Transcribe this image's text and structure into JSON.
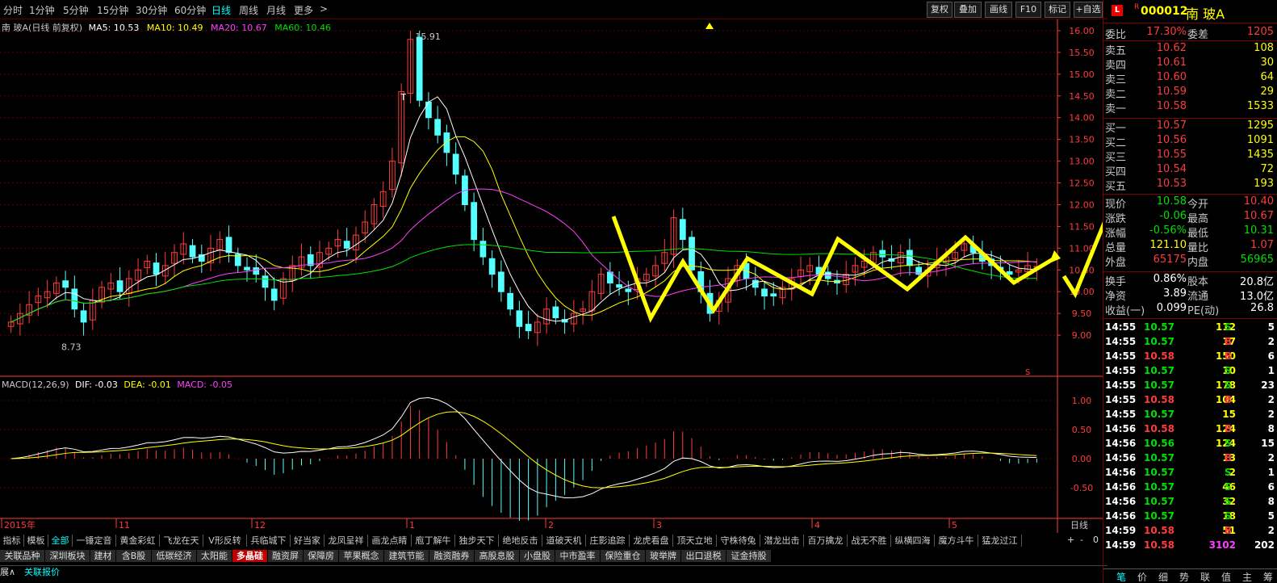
{
  "topbar": {
    "periods": [
      "分时",
      "1分钟",
      "5分钟",
      "15分钟",
      "30分钟",
      "60分钟",
      "日线",
      "周线",
      "月线",
      "更多"
    ],
    "more_arrow": ">",
    "active": "日线",
    "buttons": [
      "复权",
      "叠加",
      "画线",
      "F10",
      "标记",
      "+自选"
    ]
  },
  "legend": {
    "name": "南 玻A(日线 前复权)",
    "ma5": "MA5: 10.53",
    "ma10": "MA10: 10.49",
    "ma20": "MA20: 10.67",
    "ma60": "MA60: 10.46"
  },
  "colors": {
    "up": "#ff3c3c",
    "down": "#54ffff",
    "ma5": "#ffffff",
    "ma10": "#ffff00",
    "ma20": "#ff40ff",
    "ma60": "#00e000",
    "grid": "#7a0000",
    "axis": "#ff3c3c",
    "arrow": "#ffff00",
    "macd_pos": "#ff3c3c",
    "macd_neg": "#54ffff"
  },
  "price_axis": [
    "16.00",
    "15.50",
    "15.00",
    "14.50",
    "14.00",
    "13.50",
    "13.00",
    "12.50",
    "12.00",
    "11.50",
    "11.00",
    "10.50",
    "10.00",
    "9.50",
    "9.00"
  ],
  "annotations": {
    "high": "15.91",
    "low": "8.73",
    "t_mark": "T",
    "s_mark": "S"
  },
  "macd_legend": {
    "name": "MACD(12,26,9)",
    "dif": "DIF: -0.03",
    "dea": "DEA: -0.01",
    "macd": "MACD: -0.05"
  },
  "macd_axis": [
    "1.00",
    "0.50",
    "0.00",
    "-0.50"
  ],
  "date_axis": [
    "2015年",
    "11",
    "12",
    "1",
    "2",
    "3",
    "4",
    "5"
  ],
  "period_label": "日线",
  "indicator_tabs": [
    "指标",
    "模板",
    "全部",
    "一锤定音",
    "黄金彩虹",
    "飞龙在天",
    "V形反转",
    "兵临城下",
    "好当家",
    "龙凤呈祥",
    "画龙点睛",
    "庖丁解牛",
    "独步天下",
    "绝地反击",
    "道破天机",
    "庄影追踪",
    "龙虎看盘",
    "顶天立地",
    "守株待兔",
    "潜龙出击",
    "百万擒龙",
    "战无不胜",
    "纵横四海",
    "魔方斗牛",
    "猛龙过江"
  ],
  "indicator_active": "全部",
  "nav_controls": [
    "+",
    "-",
    "0"
  ],
  "sector_tabs": [
    "关联品种",
    "深圳板块",
    "建材",
    "含B股",
    "低碳经济",
    "太阳能",
    "多晶硅",
    "融资屏",
    "保障房",
    "苹果概念",
    "建筑节能",
    "融资融券",
    "高股息股",
    "小盘股",
    "中市盈率",
    "保险重仓",
    "玻举牌",
    "出口退税",
    "证金持股"
  ],
  "sector_active": "多晶硅",
  "status": {
    "expand": "展∧",
    "quote": "关联报价"
  },
  "right": {
    "logo": "L",
    "badge": "R",
    "code": "000012",
    "name": "南 玻A",
    "weibi_label": "委比",
    "weibi": "17.30%",
    "weicha_label": "委差",
    "weicha": "1205",
    "asks": [
      {
        "l": "卖五",
        "p": "10.62",
        "v": "108"
      },
      {
        "l": "卖四",
        "p": "10.61",
        "v": "30"
      },
      {
        "l": "卖三",
        "p": "10.60",
        "v": "64"
      },
      {
        "l": "卖二",
        "p": "10.59",
        "v": "29"
      },
      {
        "l": "卖一",
        "p": "10.58",
        "v": "1533"
      }
    ],
    "bids": [
      {
        "l": "买一",
        "p": "10.57",
        "v": "1295"
      },
      {
        "l": "买二",
        "p": "10.56",
        "v": "1091"
      },
      {
        "l": "买三",
        "p": "10.55",
        "v": "1435"
      },
      {
        "l": "买四",
        "p": "10.54",
        "v": "72"
      },
      {
        "l": "买五",
        "p": "10.53",
        "v": "193"
      }
    ],
    "stats": [
      {
        "l": "现价",
        "v": "10.58",
        "l2": "今开",
        "v2": "10.40"
      },
      {
        "l": "涨跌",
        "v": "-0.06",
        "l2": "最高",
        "v2": "10.67"
      },
      {
        "l": "涨幅",
        "v": "-0.56%",
        "l2": "最低",
        "v2": "10.31"
      },
      {
        "l": "总量",
        "v": "121.10",
        "l2": "量比",
        "v2": "1.07"
      },
      {
        "l": "外盘",
        "v": "65175",
        "l2": "内盘",
        "v2": "56965"
      }
    ],
    "fund": [
      {
        "l": "换手",
        "v": "0.86%",
        "l2": "股本",
        "v2": "20.8亿"
      },
      {
        "l": "净资",
        "v": "3.89",
        "l2": "流通",
        "v2": "13.0亿"
      },
      {
        "l": "收益(一)",
        "v": "0.099",
        "l2": "PE(动)",
        "v2": "26.8"
      }
    ],
    "ticks": [
      {
        "t": "14:55",
        "p": "10.57",
        "v": "112",
        "s": "S",
        "n": "5"
      },
      {
        "t": "14:55",
        "p": "10.57",
        "v": "17",
        "s": "B",
        "n": "2"
      },
      {
        "t": "14:55",
        "p": "10.58",
        "v": "150",
        "s": "B",
        "n": "6"
      },
      {
        "t": "14:55",
        "p": "10.57",
        "v": "10",
        "s": "S",
        "n": "1"
      },
      {
        "t": "14:55",
        "p": "10.57",
        "v": "178",
        "s": "S",
        "n": "23"
      },
      {
        "t": "14:55",
        "p": "10.58",
        "v": "104",
        "s": "B",
        "n": "2"
      },
      {
        "t": "14:55",
        "p": "10.57",
        "v": "15",
        "s": "",
        "n": "2"
      },
      {
        "t": "14:56",
        "p": "10.58",
        "v": "124",
        "s": "B",
        "n": "8"
      },
      {
        "t": "14:56",
        "p": "10.56",
        "v": "124",
        "s": "S",
        "n": "15"
      },
      {
        "t": "14:56",
        "p": "10.57",
        "v": "13",
        "s": "B",
        "n": "2"
      },
      {
        "t": "14:56",
        "p": "10.57",
        "v": "2",
        "s": "S",
        "n": "1"
      },
      {
        "t": "14:56",
        "p": "10.57",
        "v": "46",
        "s": "S",
        "n": "6"
      },
      {
        "t": "14:56",
        "p": "10.57",
        "v": "32",
        "s": "S",
        "n": "8"
      },
      {
        "t": "14:56",
        "p": "10.57",
        "v": "18",
        "s": "S",
        "n": "5"
      },
      {
        "t": "14:59",
        "p": "10.58",
        "v": "51",
        "s": "B",
        "n": "2"
      },
      {
        "t": "14:59",
        "p": "10.58",
        "v": "3102",
        "s": "",
        "n": "202"
      }
    ],
    "bottom_tabs": [
      "笔",
      "价",
      "细",
      "势",
      "联",
      "值",
      "主",
      "筹"
    ]
  },
  "chart_data": {
    "type": "candlestick",
    "title": "南 玻A(日线 前复权)",
    "ylim": [
      8.7,
      16.1
    ],
    "series_ohlc_approx": "daily candles Oct 2015 - May 2016",
    "key_points": [
      {
        "label": "high",
        "value": 15.91
      },
      {
        "label": "low",
        "value": 8.73
      }
    ],
    "closes": [
      9.3,
      9.5,
      9.7,
      9.9,
      10.0,
      10.2,
      10.1,
      9.6,
      9.3,
      9.8,
      10.1,
      10.2,
      10.0,
      10.3,
      10.5,
      10.7,
      10.4,
      10.6,
      10.9,
      11.1,
      10.8,
      10.7,
      11.0,
      11.2,
      10.9,
      10.6,
      10.5,
      10.4,
      10.1,
      9.8,
      10.3,
      10.6,
      10.8,
      10.6,
      10.9,
      11.0,
      11.2,
      11.0,
      11.3,
      11.6,
      12.0,
      12.3,
      13.0,
      14.6,
      15.8,
      14.4,
      14.0,
      13.6,
      13.2,
      12.7,
      12.0,
      11.2,
      10.8,
      10.4,
      10.0,
      9.6,
      9.2,
      9.1,
      9.3,
      9.6,
      9.4,
      9.3,
      9.5,
      9.6,
      10.0,
      10.4,
      10.2,
      10.1,
      10.0,
      10.3,
      10.4,
      10.6,
      10.9,
      11.7,
      11.2,
      10.5,
      10.0,
      9.5,
      9.8,
      10.3,
      10.6,
      10.3,
      10.1,
      9.9,
      9.9,
      10.1,
      10.3,
      10.5,
      10.6,
      10.4,
      10.3,
      10.2,
      10.4,
      10.6,
      10.7,
      10.9,
      10.8,
      10.7,
      10.9,
      10.6,
      10.4,
      10.5,
      10.7,
      10.8,
      10.9,
      11.1,
      10.9,
      10.7,
      10.6,
      10.5,
      10.4,
      10.5,
      10.6,
      10.58
    ],
    "macd": {
      "dif": -0.03,
      "dea": -0.01,
      "macd": -0.05
    }
  }
}
